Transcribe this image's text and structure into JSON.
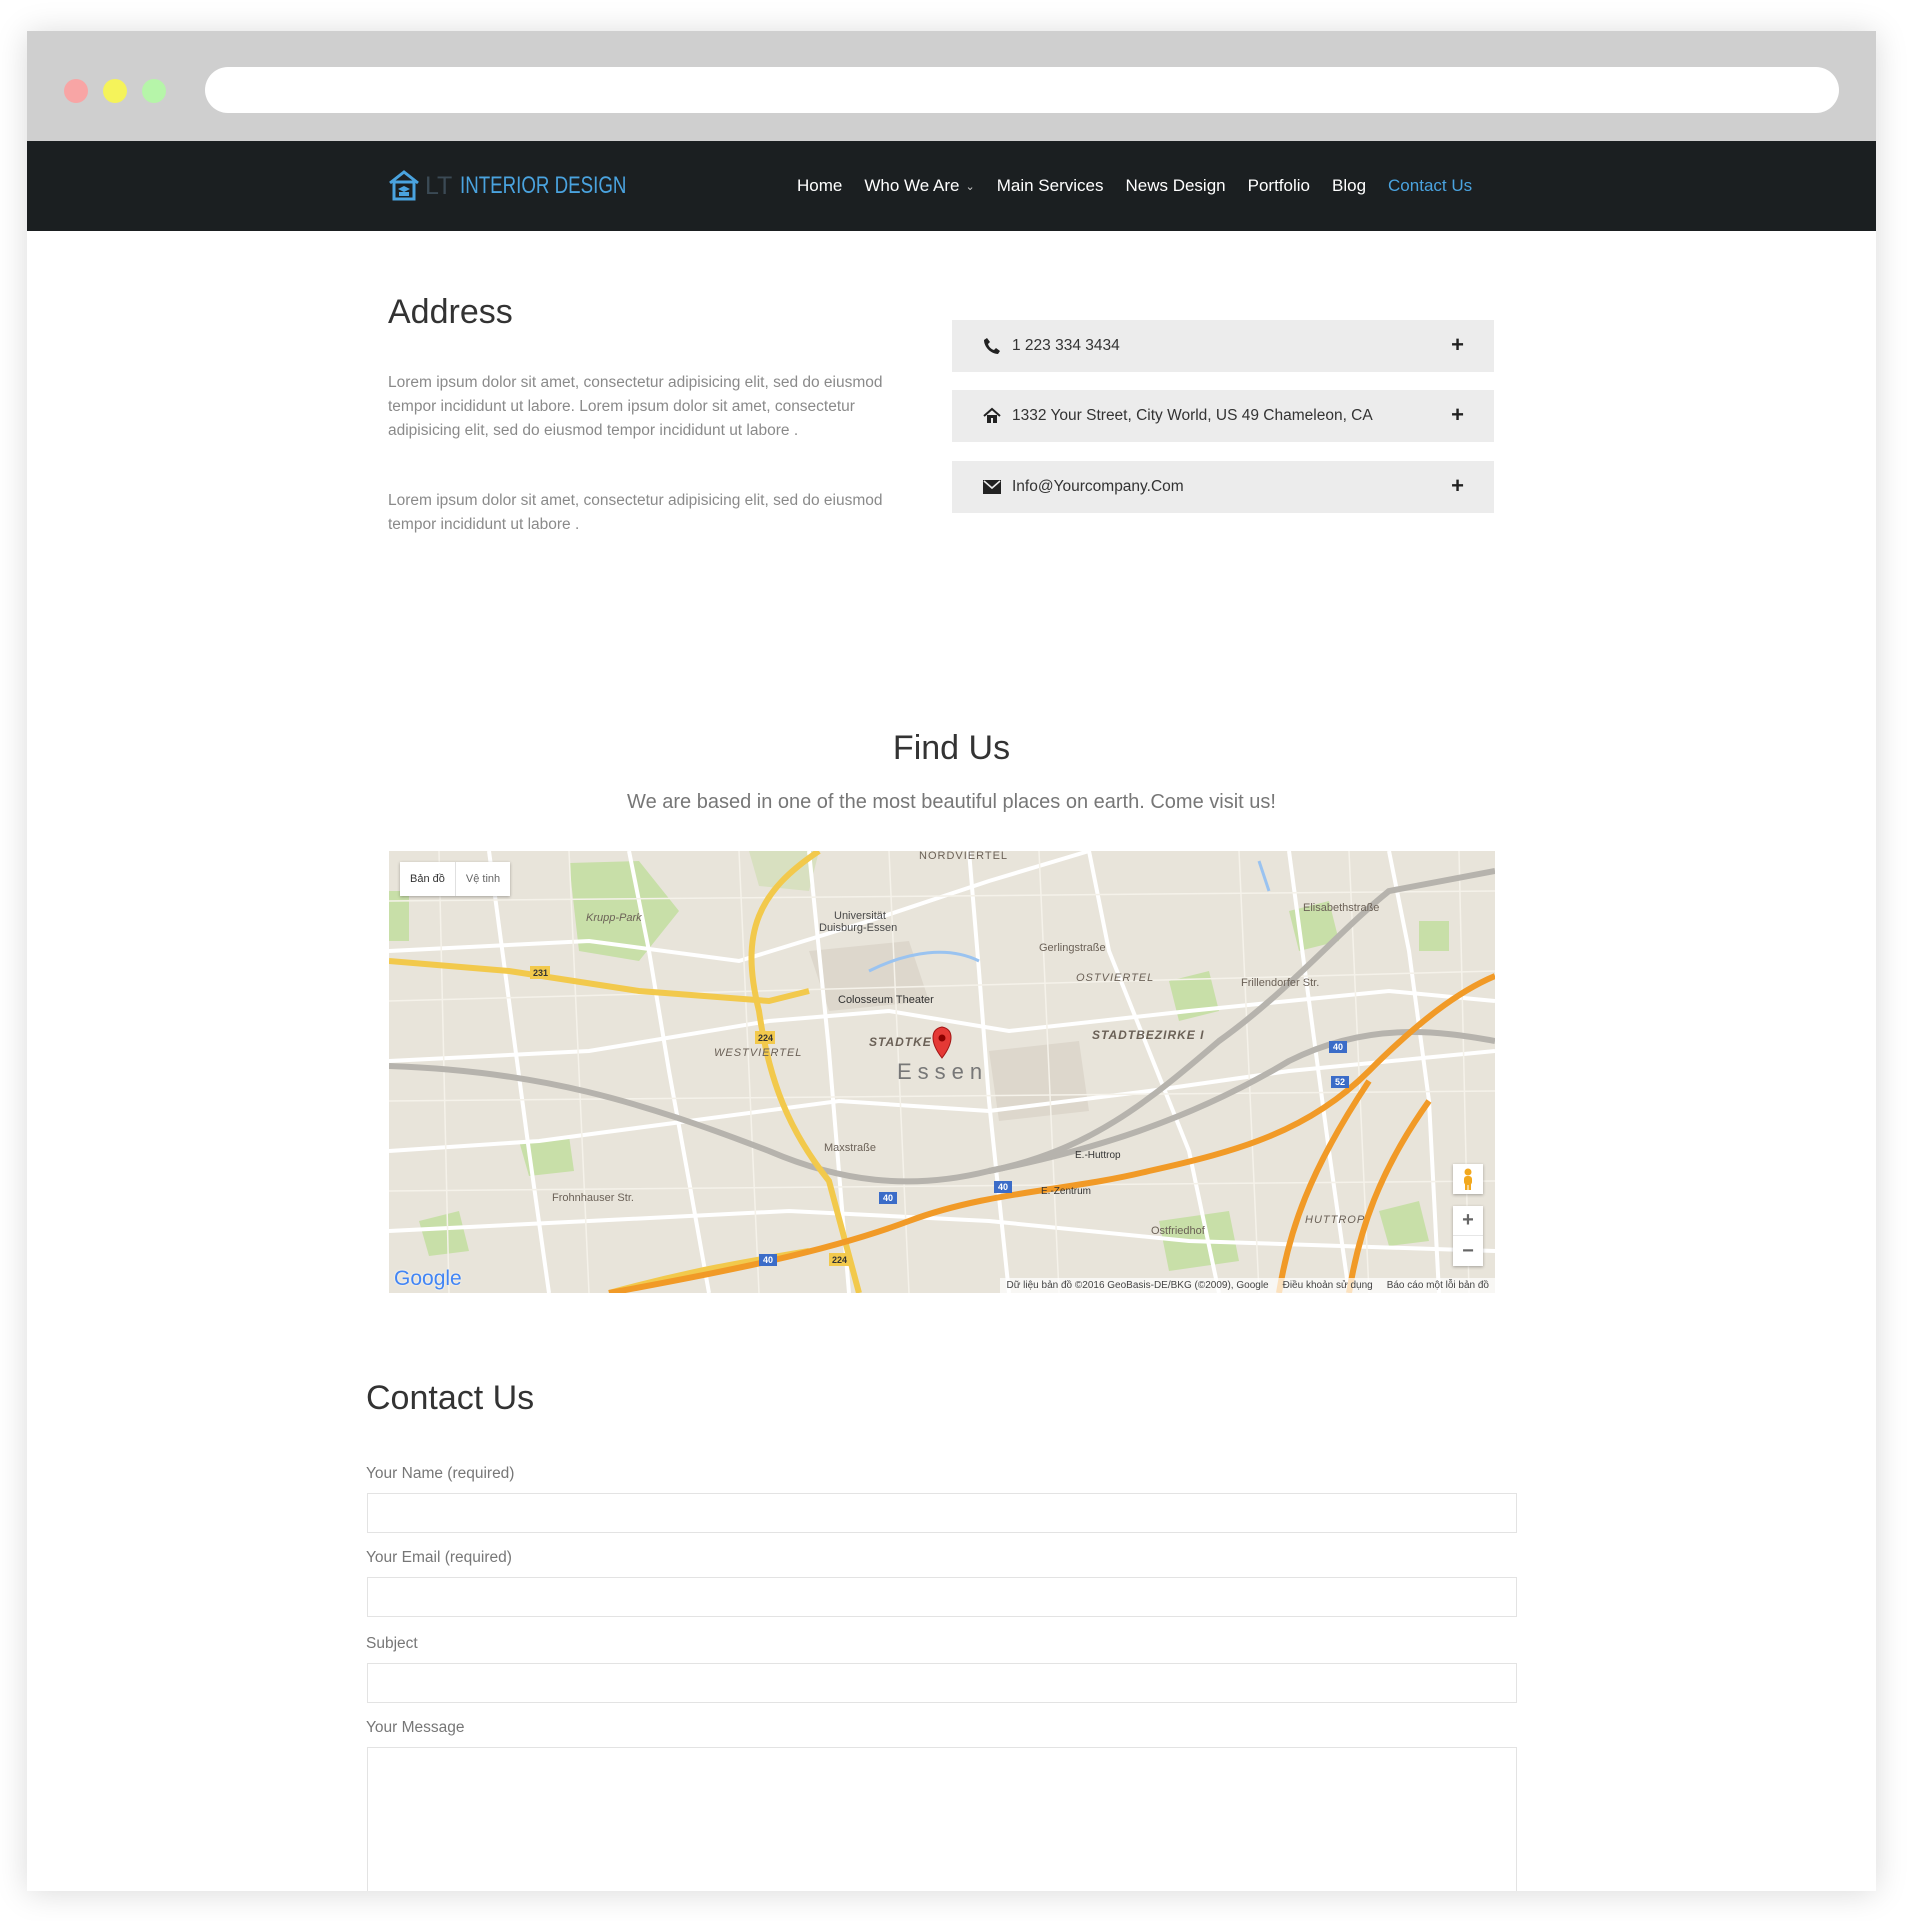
{
  "nav": {
    "logo_prefix": "LT",
    "logo_name": "INTERIOR DESIGN",
    "items": [
      {
        "label": "Home"
      },
      {
        "label": "Who We Are"
      },
      {
        "label": "Main Services"
      },
      {
        "label": "News Design"
      },
      {
        "label": "Portfolio"
      },
      {
        "label": "Blog"
      },
      {
        "label": "Contact Us"
      }
    ],
    "active_color": "#4aa3df"
  },
  "address": {
    "title": "Address",
    "paragraph1": "Lorem ipsum dolor sit amet, consectetur adipisicing elit, sed do eiusmod tempor incididunt ut labore. Lorem ipsum dolor sit amet, consectetur adipisicing elit, sed do eiusmod tempor incididunt ut labore .",
    "paragraph2": "Lorem ipsum dolor sit amet, consectetur adipisicing elit, sed do eiusmod tempor incididunt ut labore ."
  },
  "contact_info": [
    {
      "icon": "phone-icon",
      "text": "1 223 334 3434"
    },
    {
      "icon": "home-icon",
      "text": "1332 Your Street, City World, US 49 Chameleon, CA"
    },
    {
      "icon": "envelope-icon",
      "text": "Info@Yourcompany.Com"
    }
  ],
  "find_us": {
    "title": "Find Us",
    "subtitle": "We are based in one of the most beautiful places on earth. Come visit us!"
  },
  "map": {
    "type_map": "Bản đồ",
    "type_satellite": "Vệ tinh",
    "city_label": "Essen",
    "labels": {
      "nordviertel": "NORDVIERTEL",
      "krupp": "Krupp-Park",
      "uni": "Universität Duisburg-Essen",
      "gerling": "Gerlingstraße",
      "ostviertel": "OSTVIERTEL",
      "colosseum": "Colosseum Theater",
      "westviertel": "WESTVIERTEL",
      "stadtkern": "STADTKE",
      "stadtbezirke": "STADTBEZIRKE I",
      "huttrop": "HUTTROP",
      "frohnhauser": "Frohnhauser Str.",
      "maxstr": "Maxstraße",
      "ostfriedhof": "Ostfriedhof",
      "frillendorfer": "Frillendorfer Str.",
      "elisabeth": "Elisabethstraße",
      "ehuttrop": "E.-Huttrop",
      "ezentrum": "E.-Zentrum"
    },
    "zoom_in": "+",
    "zoom_out": "−",
    "google": "Google",
    "attribution": "Dữ liệu bản đồ ©2016 GeoBasis-DE/BKG (©2009), Google",
    "terms": "Điều khoản sử dụng",
    "report": "Báo cáo một lỗi bản đồ"
  },
  "contact_form": {
    "title": "Contact Us",
    "name_label": "Your Name (required)",
    "email_label": "Your Email (required)",
    "subject_label": "Subject",
    "message_label": "Your Message",
    "name_value": "",
    "email_value": "",
    "subject_value": "",
    "message_value": ""
  }
}
